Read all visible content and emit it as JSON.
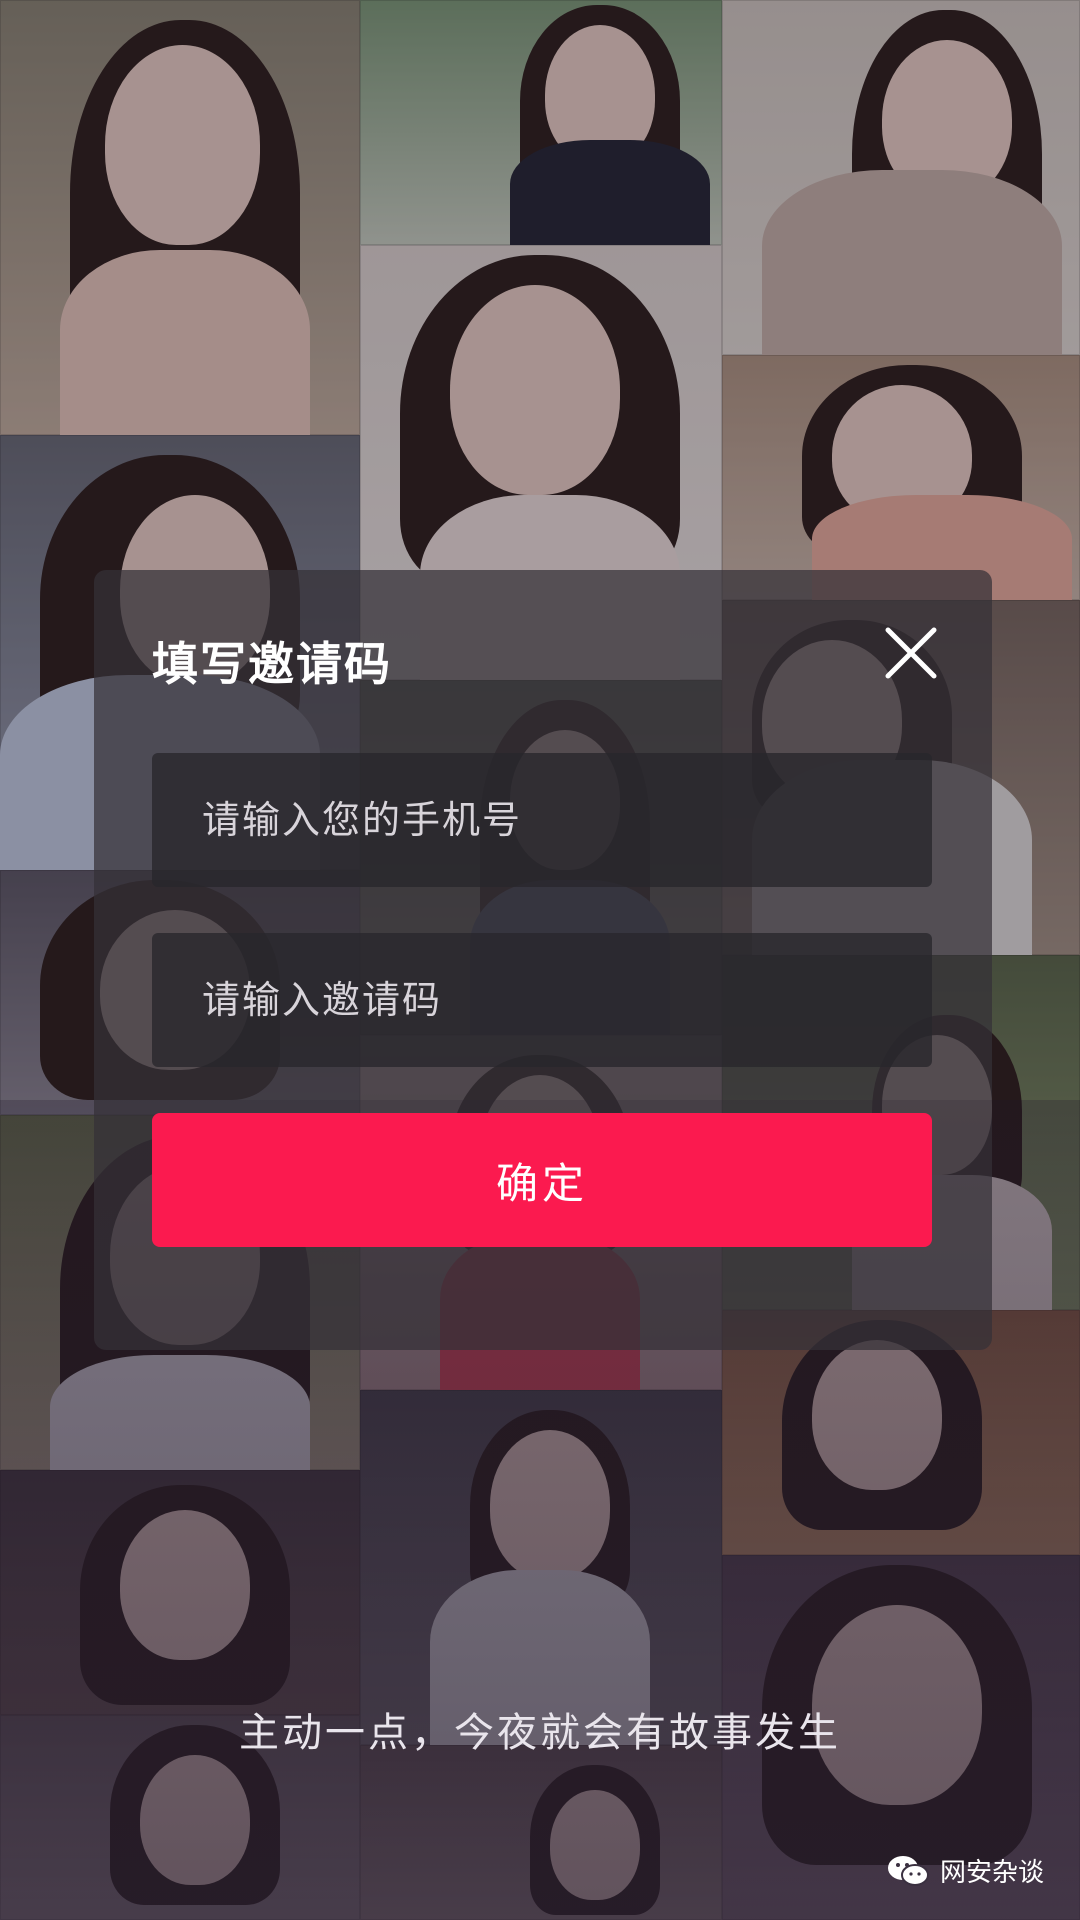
{
  "modal": {
    "title": "填写邀请码",
    "phone_placeholder": "请输入您的手机号",
    "code_placeholder": "请输入邀请码",
    "confirm_label": "确定",
    "close_icon": "close-icon"
  },
  "slogan": "主动一点，今夜就会有故事发生",
  "watermark": {
    "icon": "wechat-icon",
    "text": "网安杂谈"
  },
  "colors": {
    "accent": "#fb1a4f",
    "modal_bg": "rgba(52,48,56,0.72)"
  },
  "background": {
    "description_icon": "photo-tile"
  }
}
